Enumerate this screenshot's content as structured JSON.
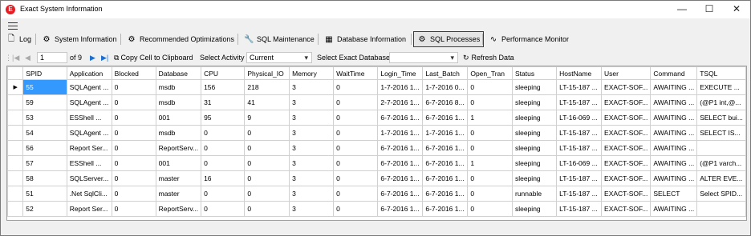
{
  "window": {
    "title": "Exact System Information",
    "app_icon": "E"
  },
  "tabs": [
    {
      "label": "Log",
      "icon": "log-icon"
    },
    {
      "label": "System Information",
      "icon": "gear-icon"
    },
    {
      "label": "Recommended Optimizations",
      "icon": "gear-icon"
    },
    {
      "label": "SQL Maintenance",
      "icon": "wrench-icon"
    },
    {
      "label": "Database Information",
      "icon": "database-icon"
    },
    {
      "label": "SQL Processes",
      "icon": "gears-icon"
    },
    {
      "label": "Performance Monitor",
      "icon": "monitor-icon"
    }
  ],
  "navigator": {
    "position": "1",
    "of_label": "of 9",
    "copy_label": "Copy Cell to Clipboard",
    "select_activity_label": "Select Activity",
    "activity_value": "Current",
    "select_db_label": "Select Exact Database",
    "db_value": "",
    "refresh_label": "Refresh Data"
  },
  "grid": {
    "columns": [
      "SPID",
      "Application",
      "Blocked",
      "Database",
      "CPU",
      "Physical_IO",
      "Memory",
      "WaitTime",
      "Login_Time",
      "Last_Batch",
      "Open_Tran",
      "Status",
      "HostName",
      "User",
      "Command",
      "TSQL"
    ],
    "rows": [
      [
        "55",
        "SQLAgent ...",
        "0",
        "msdb",
        "156",
        "218",
        "3",
        "0",
        "1-7-2016 1...",
        "1-7-2016 0...",
        "0",
        "sleeping",
        "LT-15-187 ...",
        "EXACT-SOF...",
        "AWAITING ...",
        "EXECUTE ..."
      ],
      [
        "59",
        "SQLAgent ...",
        "0",
        "msdb",
        "31",
        "41",
        "3",
        "0",
        "2-7-2016 1...",
        "6-7-2016 8...",
        "0",
        "sleeping",
        "LT-15-187 ...",
        "EXACT-SOF...",
        "AWAITING ...",
        "(@P1 int,@..."
      ],
      [
        "53",
        "ESShell ...",
        "0",
        "001",
        "95",
        "9",
        "3",
        "0",
        "6-7-2016 1...",
        "6-7-2016 1...",
        "1",
        "sleeping",
        "LT-16-069 ...",
        "EXACT-SOF...",
        "AWAITING ...",
        "SELECT bui..."
      ],
      [
        "54",
        "SQLAgent ...",
        "0",
        "msdb",
        "0",
        "0",
        "3",
        "0",
        "1-7-2016 1...",
        "1-7-2016 1...",
        "0",
        "sleeping",
        "LT-15-187 ...",
        "EXACT-SOF...",
        "AWAITING ...",
        "SELECT IS..."
      ],
      [
        "56",
        "Report Ser...",
        "0",
        "ReportServ...",
        "0",
        "0",
        "3",
        "0",
        "6-7-2016 1...",
        "6-7-2016 1...",
        "0",
        "sleeping",
        "LT-15-187 ...",
        "EXACT-SOF...",
        "AWAITING ...",
        ""
      ],
      [
        "57",
        "ESShell ...",
        "0",
        "001",
        "0",
        "0",
        "3",
        "0",
        "6-7-2016 1...",
        "6-7-2016 1...",
        "1",
        "sleeping",
        "LT-16-069 ...",
        "EXACT-SOF...",
        "AWAITING ...",
        "(@P1 varch..."
      ],
      [
        "58",
        "SQLServer...",
        "0",
        "master",
        "16",
        "0",
        "3",
        "0",
        "6-7-2016 1...",
        "6-7-2016 1...",
        "0",
        "sleeping",
        "LT-15-187 ...",
        "EXACT-SOF...",
        "AWAITING ...",
        "ALTER EVE..."
      ],
      [
        "51",
        ".Net SqlCli...",
        "0",
        "master",
        "0",
        "0",
        "3",
        "0",
        "6-7-2016 1...",
        "6-7-2016 1...",
        "0",
        "runnable",
        "LT-15-187 ...",
        "EXACT-SOF...",
        "SELECT",
        "Select SPID..."
      ],
      [
        "52",
        "Report Ser...",
        "0",
        "ReportServ...",
        "0",
        "0",
        "3",
        "0",
        "6-7-2016 1...",
        "6-7-2016 1...",
        "0",
        "sleeping",
        "LT-15-187 ...",
        "EXACT-SOF...",
        "AWAITING ...",
        ""
      ]
    ]
  },
  "colors": {
    "selection": "#3399ff",
    "accent": "#e31e24"
  }
}
